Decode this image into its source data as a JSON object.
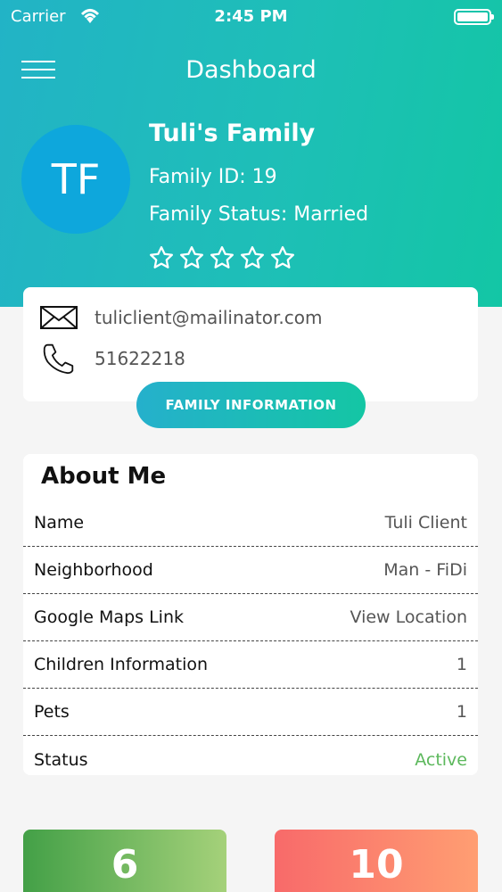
{
  "status_bar": {
    "carrier": "Carrier",
    "time": "2:45 PM"
  },
  "nav": {
    "title": "Dashboard"
  },
  "profile": {
    "initials": "TF",
    "family_name": "Tuli's Family",
    "family_id": "Family ID: 19",
    "family_status": "Family Status: Married",
    "rating": 0,
    "max_rating": 5
  },
  "contact": {
    "email": "tuliclient@mailinator.com",
    "phone": "51622218"
  },
  "family_info_button": "FAMILY INFORMATION",
  "about": {
    "title": "About Me",
    "rows": [
      {
        "label": "Name",
        "value": "Tuli Client"
      },
      {
        "label": "Neighborhood",
        "value": "Man - FiDi"
      },
      {
        "label": "Google Maps Link",
        "value": "View Location"
      },
      {
        "label": "Children Information",
        "value": "1"
      },
      {
        "label": "Pets",
        "value": "1"
      },
      {
        "label": "Status",
        "value": "Active"
      }
    ]
  },
  "stats": [
    {
      "value": "6"
    },
    {
      "value": "10"
    }
  ],
  "colors": {
    "header_gradient_start": "#22b3c6",
    "header_gradient_end": "#13c6a5",
    "avatar": "#0ea7dc",
    "active_status": "#5cb85c",
    "stat_green": "#43a047",
    "stat_red": "#f86a6a"
  }
}
